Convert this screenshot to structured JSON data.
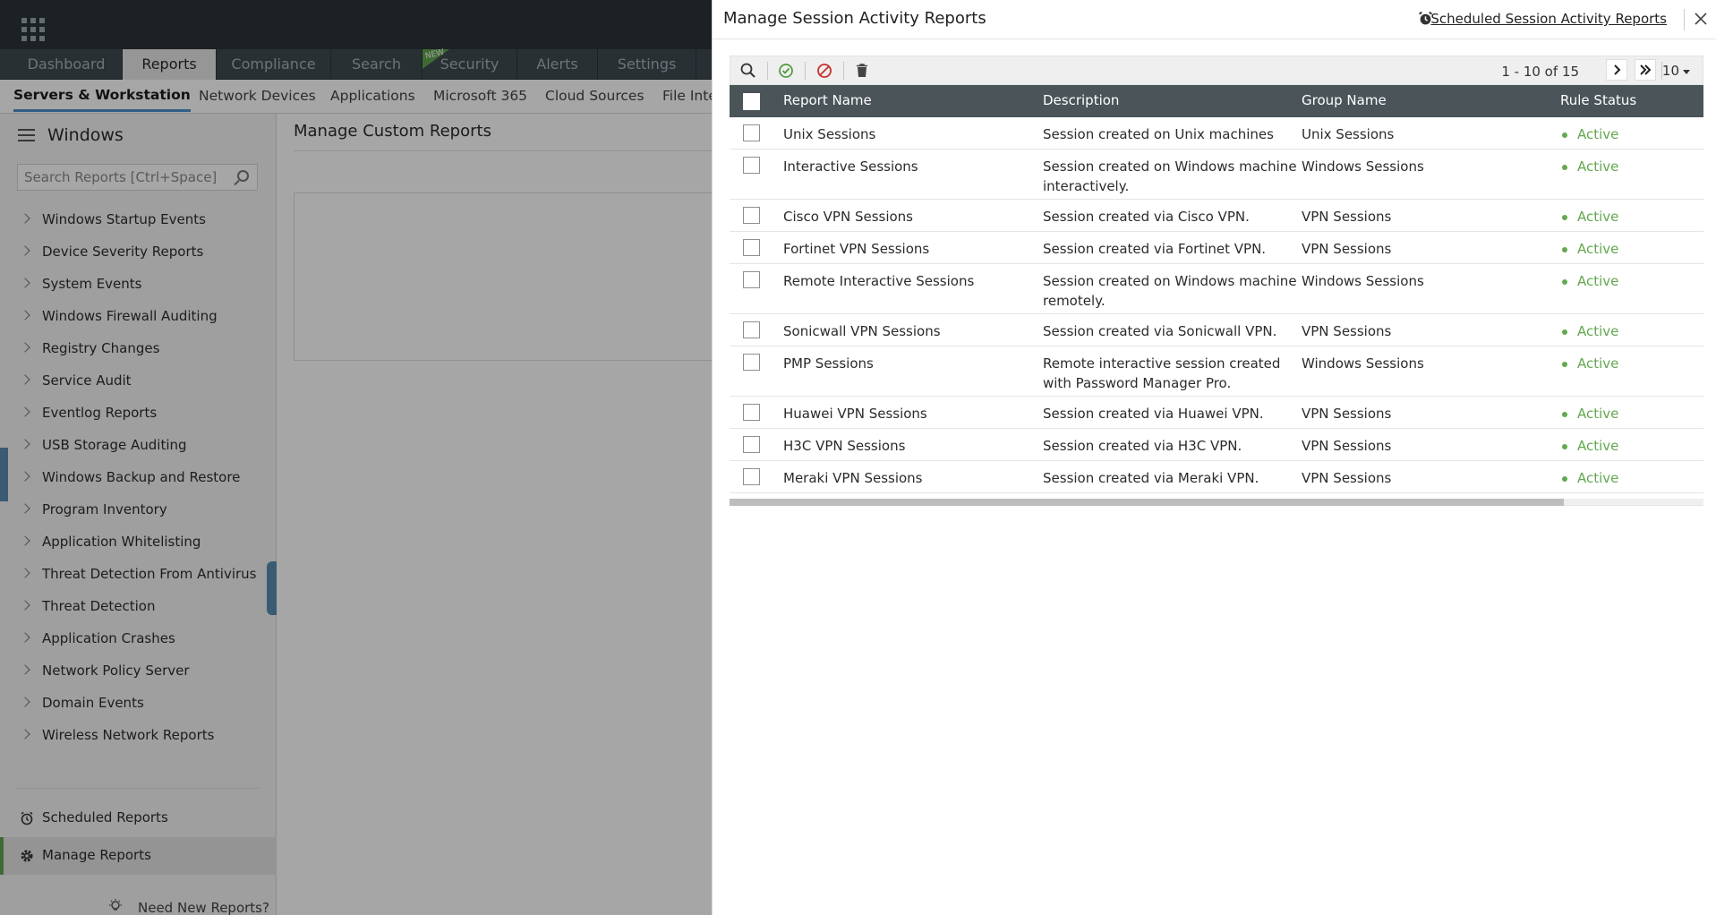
{
  "main_nav": {
    "tabs": [
      "Dashboard",
      "Reports",
      "Compliance",
      "Search",
      "Security",
      "Alerts",
      "Settings"
    ],
    "active": "Reports",
    "new_badge": "NEW"
  },
  "sub_nav": {
    "items": [
      "Servers & Workstation",
      "Network Devices",
      "Applications",
      "Microsoft 365",
      "Cloud Sources",
      "File Inte"
    ],
    "active": "Servers & Workstation"
  },
  "sidebar": {
    "title": "Windows",
    "search_placeholder": "Search Reports [Ctrl+Space]",
    "items": [
      "Windows Startup Events",
      "Device Severity Reports",
      "System Events",
      "Windows Firewall Auditing",
      "Registry Changes",
      "Service Audit",
      "Eventlog Reports",
      "USB Storage Auditing",
      "Windows Backup and Restore",
      "Program Inventory",
      "Application Whitelisting",
      "Threat Detection From Antivirus",
      "Threat Detection",
      "Application Crashes",
      "Network Policy Server",
      "Domain Events",
      "Wireless Network Reports"
    ],
    "scheduled_reports": "Scheduled Reports",
    "manage_reports": "Manage Reports",
    "need_new_reports": "Need New Reports?"
  },
  "content": {
    "title": "Manage Custom Reports"
  },
  "drawer": {
    "title": "Manage Session Activity Reports",
    "scheduled_link": "Scheduled Session Activity Reports",
    "pager": {
      "range": "1 - 10 of 15",
      "page_size": "10"
    },
    "columns": {
      "report_name": "Report Name",
      "description": "Description",
      "group_name": "Group Name",
      "rule_status": "Rule Status"
    },
    "rows": [
      {
        "name": "Unix Sessions",
        "description": "Session created on Unix machines",
        "group": "Unix Sessions",
        "status": "Active"
      },
      {
        "name": "Interactive Sessions",
        "description": "Session created on Windows machine interactively.",
        "group": "Windows Sessions",
        "status": "Active"
      },
      {
        "name": "Cisco VPN Sessions",
        "description": "Session created via Cisco VPN.",
        "group": "VPN Sessions",
        "status": "Active"
      },
      {
        "name": "Fortinet VPN Sessions",
        "description": "Session created via Fortinet VPN.",
        "group": "VPN Sessions",
        "status": "Active"
      },
      {
        "name": "Remote Interactive Sessions",
        "description": "Session created on Windows machine remotely.",
        "group": "Windows Sessions",
        "status": "Active"
      },
      {
        "name": "Sonicwall VPN Sessions",
        "description": "Session created via Sonicwall VPN.",
        "group": "VPN Sessions",
        "status": "Active"
      },
      {
        "name": "PMP Sessions",
        "description": "Remote interactive session created with Password Manager Pro.",
        "group": "Windows Sessions",
        "status": "Active"
      },
      {
        "name": "Huawei VPN Sessions",
        "description": "Session created via Huawei VPN.",
        "group": "VPN Sessions",
        "status": "Active"
      },
      {
        "name": "H3C VPN Sessions",
        "description": "Session created via H3C VPN.",
        "group": "VPN Sessions",
        "status": "Active"
      },
      {
        "name": "Meraki VPN Sessions",
        "description": "Session created via Meraki VPN.",
        "group": "VPN Sessions",
        "status": "Active"
      }
    ]
  },
  "colors": {
    "header_bar": "#2b3336",
    "nav_bar": "#3e4a50",
    "table_header": "#4a5459",
    "status_active": "#63a84f",
    "accent_green": "#61a44f"
  }
}
